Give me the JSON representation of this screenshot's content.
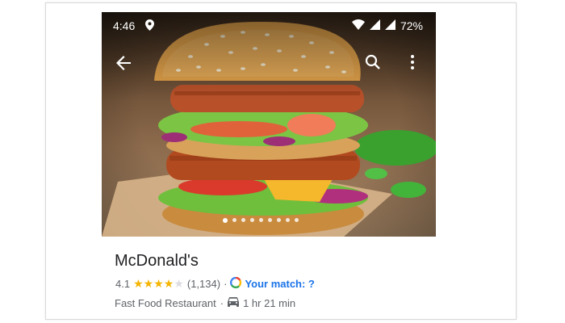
{
  "status_bar": {
    "time": "4:46",
    "battery": "72%"
  },
  "icons": {
    "location": "location-pin-icon",
    "wifi": "wifi-icon",
    "signal": "cellular-signal-icon",
    "battery": "battery-icon",
    "back": "back-arrow-icon",
    "search": "search-icon",
    "more": "more-vert-icon",
    "match": "google-match-icon",
    "car": "car-icon"
  },
  "photo": {
    "carousel_count": 9,
    "active_index": 0
  },
  "place": {
    "name": "McDonald's",
    "rating": "4.1",
    "rating_value": 4.1,
    "reviews": "(1,134)",
    "separator": "·",
    "match_text": "Your match: ?",
    "category": "Fast Food Restaurant",
    "category_sep": "·",
    "drive_time": "1 hr 21 min"
  },
  "colors": {
    "star_on": "#f4b400",
    "star_off": "#dadce0",
    "match": "#1a73e8"
  }
}
